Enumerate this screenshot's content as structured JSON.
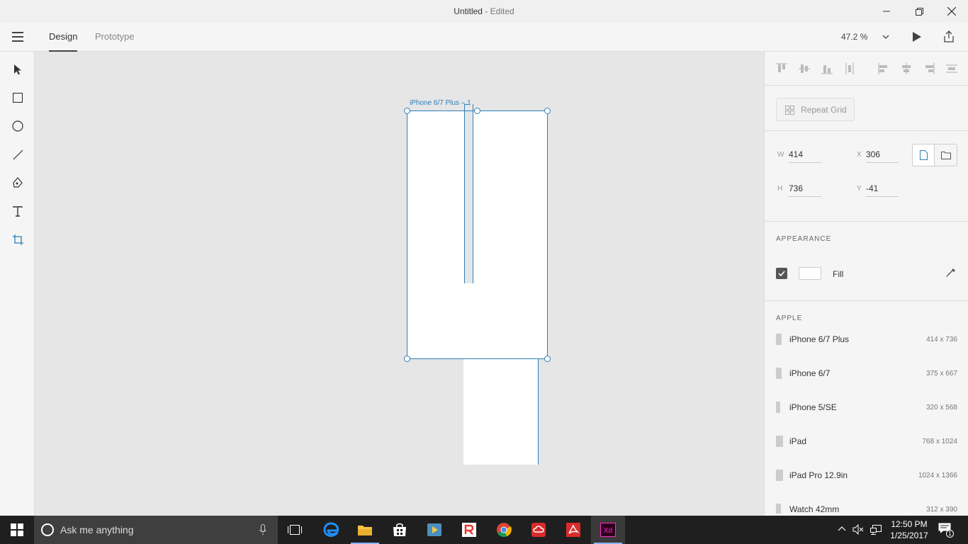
{
  "window": {
    "title": "Untitled",
    "title_suffix": "- Edited"
  },
  "tabs": [
    {
      "label": "Design",
      "active": true
    },
    {
      "label": "Prototype",
      "active": false
    }
  ],
  "zoom": "47.2 %",
  "canvas": {
    "artboard_label": "iPhone 6/7 Plus – 1",
    "artboard_fill": "#ffffff",
    "selection_color": "#2d7fb8"
  },
  "panel": {
    "repeat_grid_label": "Repeat Grid",
    "props": {
      "w_label": "W",
      "w_value": "414",
      "x_label": "X",
      "x_value": "306",
      "h_label": "H",
      "h_value": "736",
      "y_label": "Y",
      "y_value": "-41"
    },
    "appearance_heading": "APPEARANCE",
    "fill_label": "Fill",
    "fill_checked": true,
    "apple_heading": "APPLE",
    "devices": [
      {
        "name": "iPhone 6/7 Plus",
        "size": "414 x 736"
      },
      {
        "name": "iPhone 6/7",
        "size": "375 x 667"
      },
      {
        "name": "iPhone 5/SE",
        "size": "320 x 568"
      },
      {
        "name": "iPad",
        "size": "768 x 1024"
      },
      {
        "name": "iPad Pro 12.9in",
        "size": "1024 x 1366"
      },
      {
        "name": "Watch 42mm",
        "size": "312 x 390"
      }
    ]
  },
  "taskbar": {
    "search_placeholder": "Ask me anything",
    "time": "12:50 PM",
    "date": "1/25/2017",
    "notifications": "1"
  },
  "colors": {
    "accent": "#2d7fb8",
    "xd_magenta": "#ff2bc2",
    "taskbar": "#1f1f1f"
  }
}
